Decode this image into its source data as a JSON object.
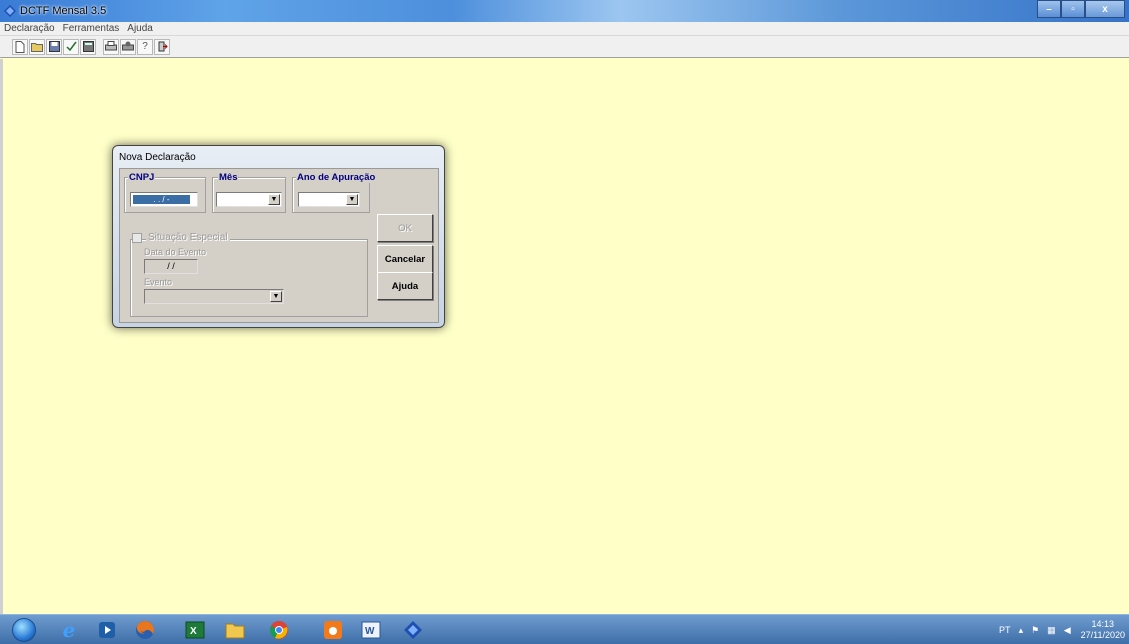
{
  "window": {
    "title": "DCTF Mensal 3.5",
    "min": "–",
    "max": "▫",
    "close": "x"
  },
  "menu": [
    "Declaração",
    "Ferramentas",
    "Ajuda"
  ],
  "toolbar": {
    "icons": [
      "new-document-icon",
      "open-folder-icon",
      "save-icon",
      "check-icon",
      "calculator-icon",
      "print-icon",
      "print-preview-icon",
      "help-icon",
      "exit-icon"
    ],
    "help_glyph": "?"
  },
  "dialog": {
    "title": "Nova Declaração",
    "cnpj_label": "CNPJ",
    "cnpj_value": "  .   .   /    -  ",
    "mes_label": "Mês",
    "mes_value": "",
    "ano_label": "Ano de Apuração",
    "ano_value": "",
    "situacao_label": "Situação Especial",
    "data_evento_label": "Data do Evento",
    "data_evento_value": "/ /",
    "evento_label": "Evento",
    "evento_value": "",
    "ok_label": "OK",
    "cancelar_label": "Cancelar",
    "ajuda_label": "Ajuda"
  },
  "taskbar": {
    "apps": [
      "internet-explorer-icon",
      "media-player-icon",
      "firefox-icon",
      "excel-icon",
      "file-explorer-icon",
      "chrome-icon",
      "avast-icon",
      "word-icon",
      "dctf-icon"
    ],
    "tray_lang": "PT",
    "time": "14:13",
    "date": "27/11/2020"
  }
}
